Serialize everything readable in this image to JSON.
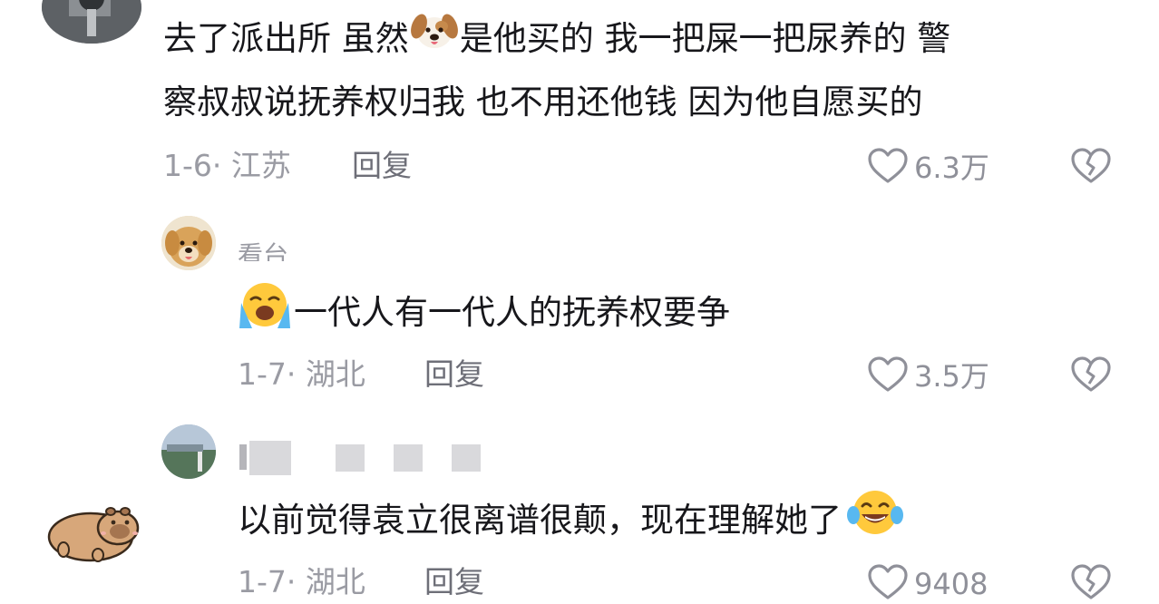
{
  "comments": [
    {
      "text_part1": "去了派出所 虽然",
      "text_part2": "是他买的 我一把屎一把尿养的 警",
      "text_line2": "察叔叔说抚养权归我 也不用还他钱 因为他自愿买的",
      "meta": "1-6· 江苏",
      "reply_label": "回复",
      "likes": "6.3万",
      "emoji": "dog-face"
    },
    {
      "username": "看台",
      "text": "一代人有一代人的抚养权要争",
      "meta": "1-7· 湖北",
      "reply_label": "回复",
      "likes": "3.5万",
      "emoji": "loudly-crying-face"
    },
    {
      "text": "以前觉得袁立很离谱很颠，现在理解她了",
      "meta": "1-7· 湖北",
      "reply_label": "回复",
      "likes": "9408",
      "emoji": "tears-of-joy-face"
    }
  ],
  "colors": {
    "primary_text": "#17171b",
    "meta_text": "#9a9ba3",
    "reply_text": "#6e6f78",
    "icon_stroke": "#8f9099"
  }
}
